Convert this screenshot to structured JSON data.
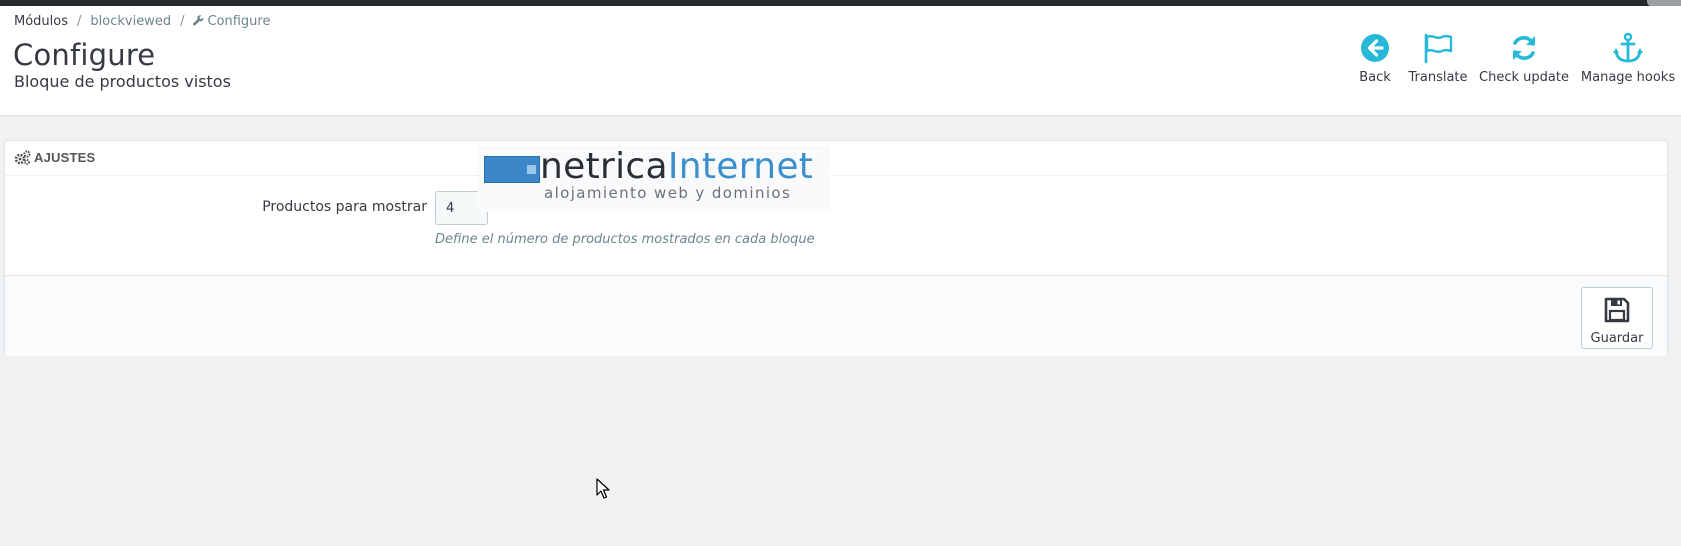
{
  "breadcrumb": {
    "items": [
      "Módulos",
      "blockviewed",
      "Configure"
    ],
    "separator": "/",
    "icons": {
      "current": "wrench-icon"
    }
  },
  "header": {
    "title": "Configure",
    "subtitle": "Bloque de productos vistos"
  },
  "toolbar": {
    "back": {
      "label": "Back",
      "icon": "arrow-circle-left-icon"
    },
    "translate": {
      "label": "Translate",
      "icon": "flag-icon"
    },
    "check_update": {
      "label": "Check update",
      "icon": "refresh-icon"
    },
    "manage_hooks": {
      "label": "Manage hooks",
      "icon": "anchor-icon"
    }
  },
  "panel": {
    "heading": "AJUSTES",
    "heading_icon": "cogs-icon",
    "field": {
      "label": "Productos para mostrar",
      "value": "4",
      "help": "Define el número de productos mostrados en cada bloque"
    },
    "save": {
      "label": "Guardar",
      "icon": "floppy-disk-icon"
    }
  },
  "logo": {
    "name_part1": "netrica",
    "name_part2": "Internet",
    "tagline": "alojamiento web y dominios"
  },
  "colors": {
    "accent": "#25b9d7",
    "topbar": "#25282d",
    "page_background": "#eff1f2",
    "logo_blue": "#3d8fcb"
  }
}
